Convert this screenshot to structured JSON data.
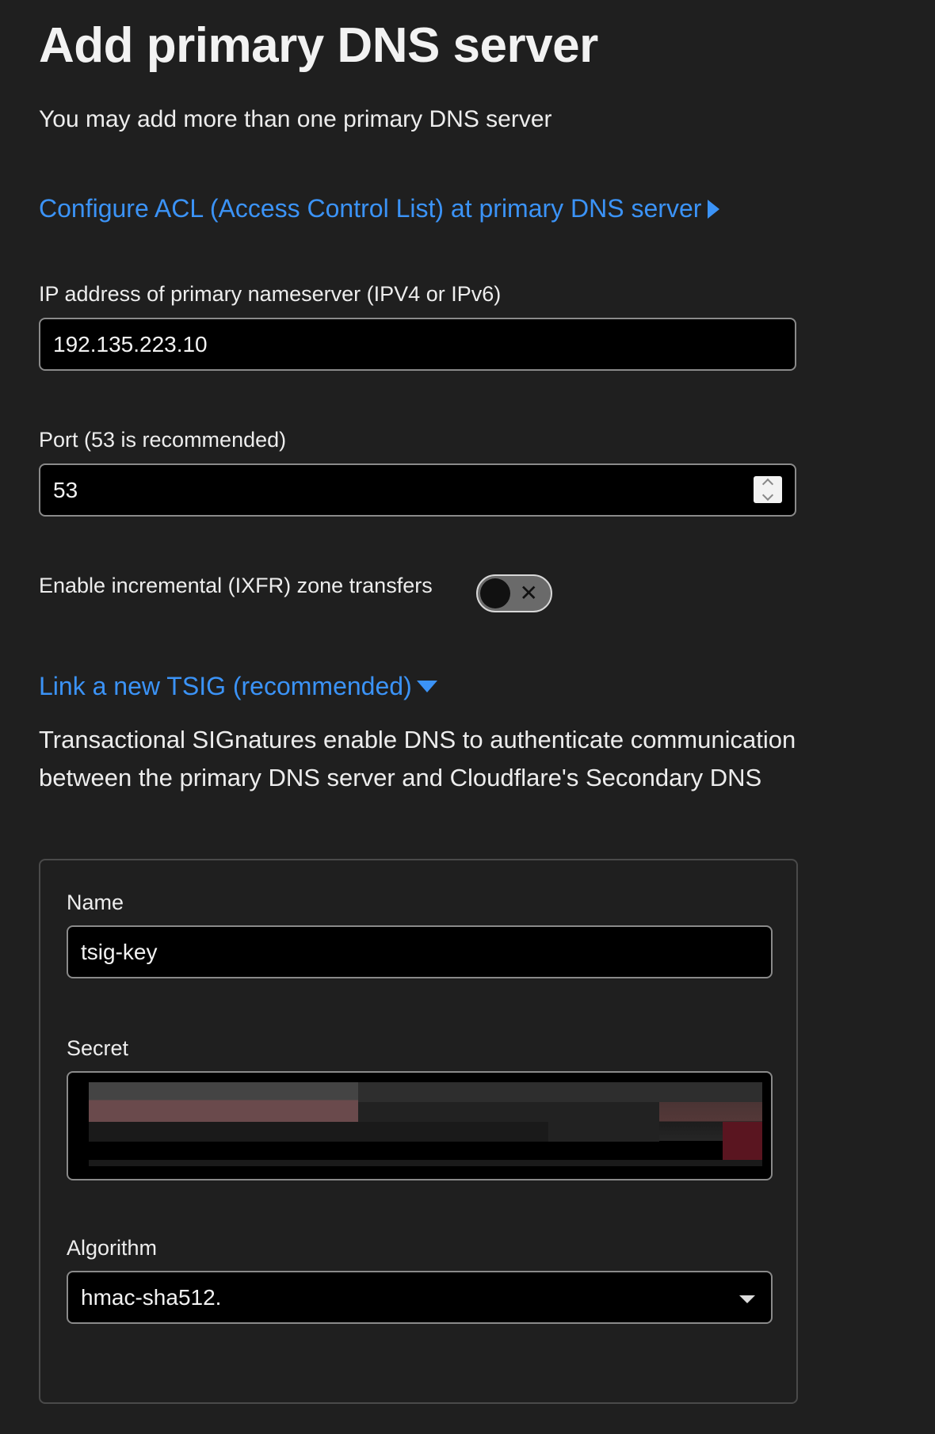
{
  "page": {
    "title": "Add primary DNS server",
    "subtitle": "You may add more than one primary DNS server"
  },
  "acl_link": {
    "label": "Configure ACL (Access Control List) at primary DNS server",
    "icon": "triangle-right-icon",
    "color": "#3b93f7"
  },
  "ip_field": {
    "label": "IP address of primary nameserver (IPV4 or IPv6)",
    "value": "192.135.223.10"
  },
  "port_field": {
    "label": "Port (53 is recommended)",
    "value": "53"
  },
  "ixfr_toggle": {
    "label": "Enable incremental (IXFR) zone transfers",
    "state": "off",
    "icon": "x-icon"
  },
  "tsig_link": {
    "label": "Link a new TSIG (recommended)",
    "icon": "triangle-down-icon",
    "color": "#3b93f7"
  },
  "tsig_description": "Transactional SIGnatures enable DNS to authenticate communication between the primary DNS server and Cloudflare's Secondary DNS",
  "tsig_panel": {
    "name_field": {
      "label": "Name",
      "value": "tsig-key"
    },
    "secret_field": {
      "label": "Secret",
      "redacted": true
    },
    "algorithm_field": {
      "label": "Algorithm",
      "selected": "hmac-sha512."
    }
  }
}
